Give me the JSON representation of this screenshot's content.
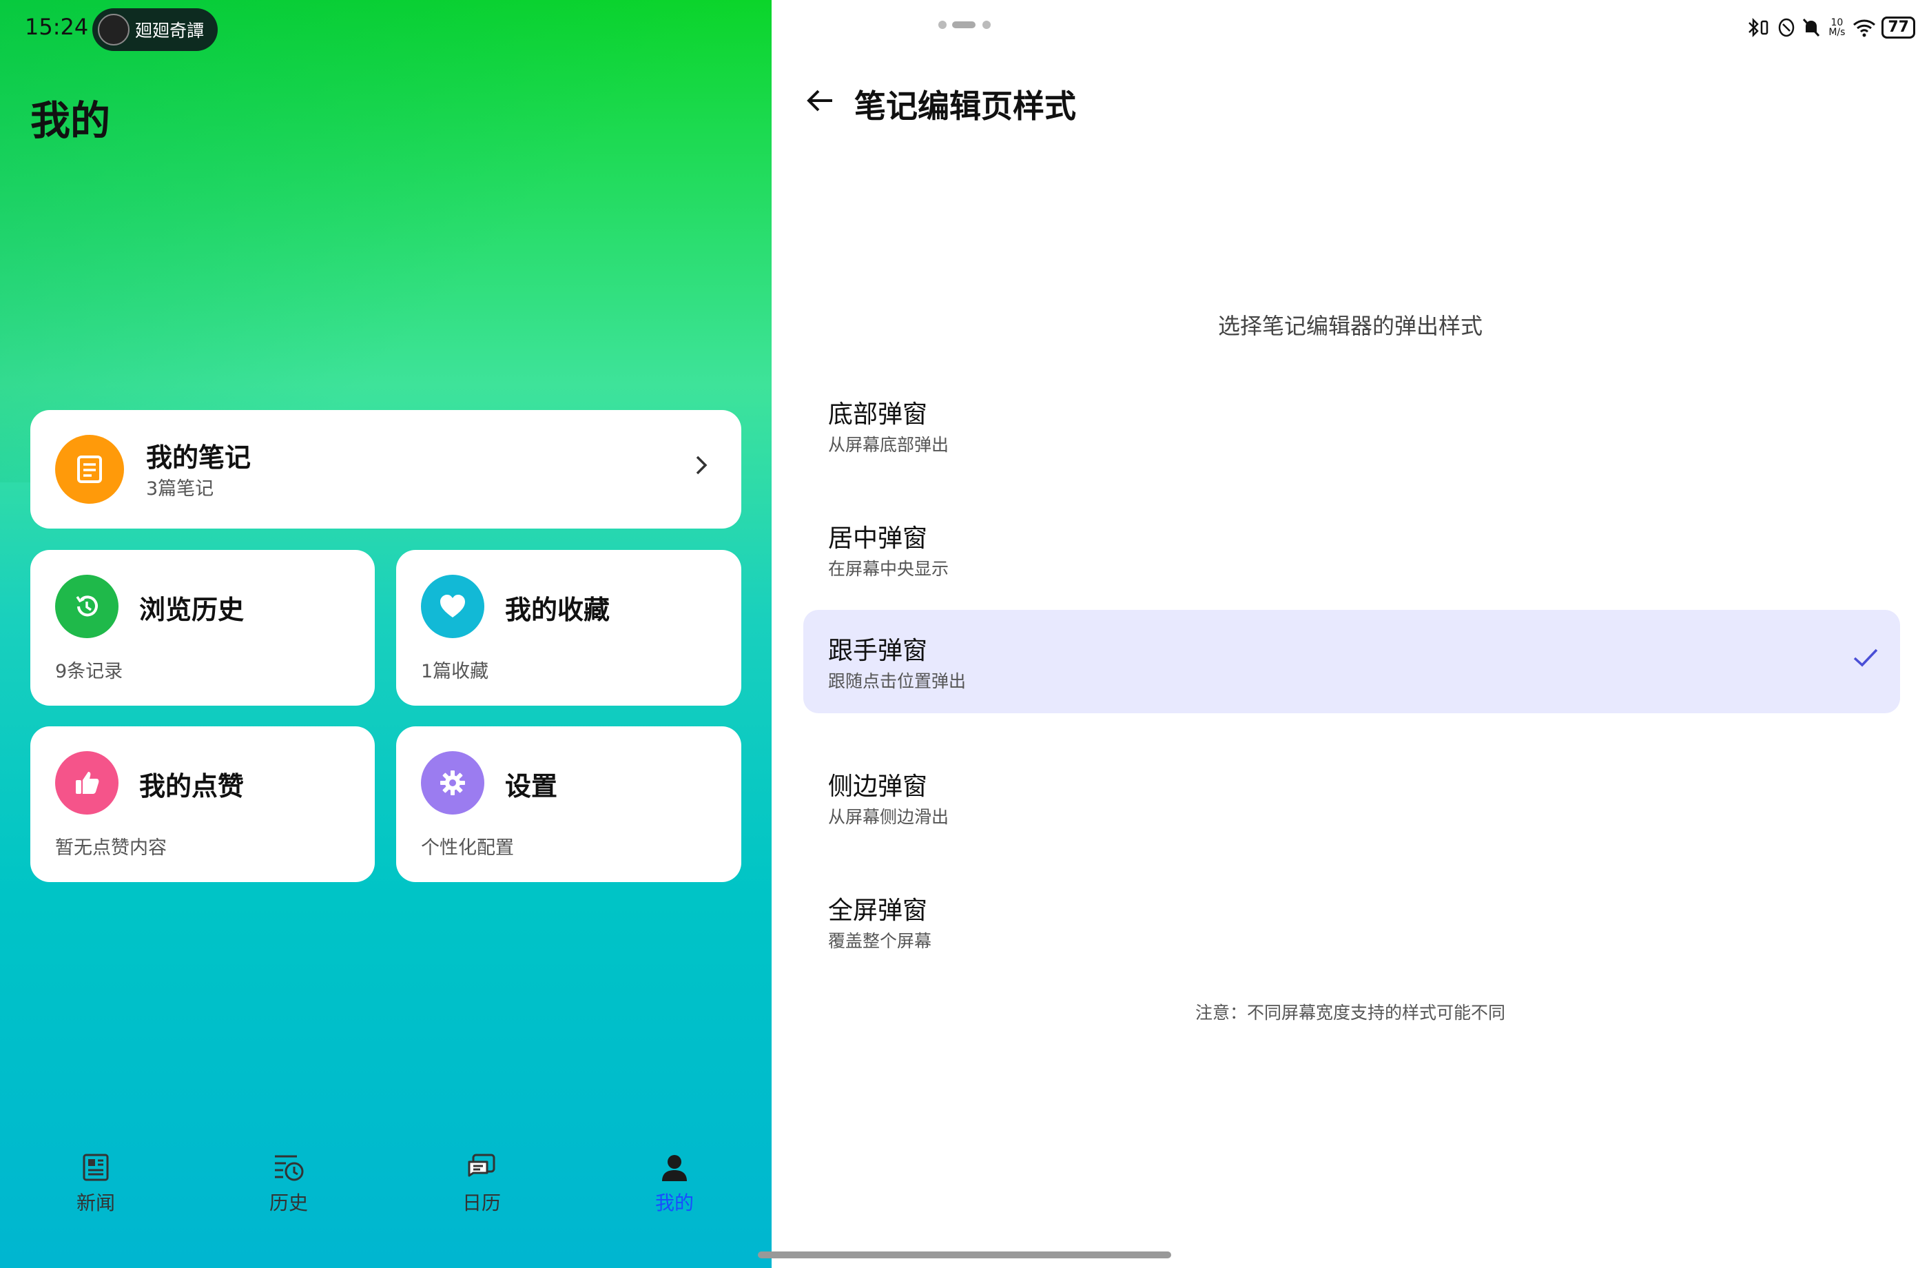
{
  "status_bar": {
    "time": "15:24",
    "pill_text": "廻廻奇譚",
    "speed": "10 M/s",
    "battery": "77"
  },
  "left": {
    "title": "我的",
    "notes_card": {
      "title": "我的笔记",
      "sub": "3篇笔记",
      "icon": "note-icon",
      "color": "#ff9a0a"
    },
    "history_card": {
      "title": "浏览历史",
      "sub": "9条记录",
      "icon": "history-icon",
      "color": "#1fb94a"
    },
    "favorites_card": {
      "title": "我的收藏",
      "sub": "1篇收藏",
      "icon": "heart-icon",
      "color": "#12b9d6"
    },
    "likes_card": {
      "title": "我的点赞",
      "sub": "暂无点赞内容",
      "icon": "thumbs-up-icon",
      "color": "#f5548a"
    },
    "settings_card": {
      "title": "设置",
      "sub": "个性化配置",
      "icon": "gear-icon",
      "color": "#9b7cf0"
    },
    "nav": [
      {
        "label": "新闻",
        "icon": "news-icon",
        "active": false
      },
      {
        "label": "历史",
        "icon": "history-list-icon",
        "active": false
      },
      {
        "label": "日历",
        "icon": "calendar-chat-icon",
        "active": false
      },
      {
        "label": "我的",
        "icon": "person-icon",
        "active": true
      }
    ],
    "active_color": "#1a4cff"
  },
  "right": {
    "title": "笔记编辑页样式",
    "subtitle": "选择笔记编辑器的弹出样式",
    "options": [
      {
        "title": "底部弹窗",
        "desc": "从屏幕底部弹出",
        "selected": false
      },
      {
        "title": "居中弹窗",
        "desc": "在屏幕中央显示",
        "selected": false
      },
      {
        "title": "跟手弹窗",
        "desc": "跟随点击位置弹出",
        "selected": true
      },
      {
        "title": "侧边弹窗",
        "desc": "从屏幕侧边滑出",
        "selected": false
      },
      {
        "title": "全屏弹窗",
        "desc": "覆盖整个屏幕",
        "selected": false
      }
    ],
    "note": "注意：不同屏幕宽度支持的样式可能不同",
    "selected_bg": "#e8e9fe",
    "check_color": "#4a4fd6"
  }
}
